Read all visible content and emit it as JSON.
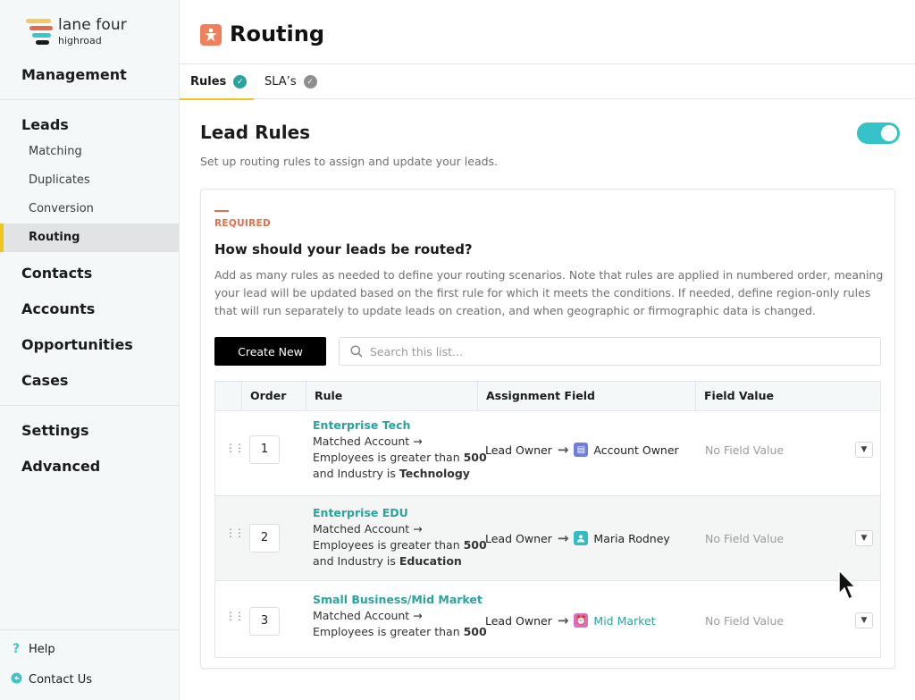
{
  "sidebar": {
    "logo": {
      "name": "lane four",
      "sub": "highroad"
    },
    "management": "Management",
    "leads": {
      "label": "Leads",
      "items": [
        {
          "label": "Matching",
          "active": false
        },
        {
          "label": "Duplicates",
          "active": false
        },
        {
          "label": "Conversion",
          "active": false
        },
        {
          "label": "Routing",
          "active": true
        }
      ]
    },
    "groups": [
      "Contacts",
      "Accounts",
      "Opportunities",
      "Cases"
    ],
    "settings": "Settings",
    "advanced": "Advanced",
    "footer": [
      {
        "label": "Help",
        "icon": "question-icon"
      },
      {
        "label": "Contact Us",
        "icon": "chat-icon"
      }
    ]
  },
  "header": {
    "title": "Routing",
    "tabs": [
      {
        "label": "Rules",
        "active": true,
        "status": "complete"
      },
      {
        "label": "SLA’s",
        "active": false,
        "status": "complete"
      }
    ]
  },
  "lead_rules": {
    "title": "Lead Rules",
    "description": "Set up routing rules to assign and update your leads.",
    "enabled": true
  },
  "card": {
    "required_label": "REQUIRED",
    "question": "How should your leads be routed?",
    "description": "Add as many rules as needed to define your routing scenarios. Note that rules are applied in numbered order, meaning your lead will be updated based on the first rule for which it meets the conditions. If needed, define region-only rules that will run separately to update leads on creation, and when geographic or firmographic data is changed.",
    "create_button": "Create New",
    "search_placeholder": "Search this list...",
    "table": {
      "columns": [
        "Order",
        "Rule",
        "Assignment Field",
        "Field Value"
      ],
      "rows": [
        {
          "order": "1",
          "name": "Enterprise Tech",
          "line1": "Matched Account →",
          "line2_pre": "Employees is greater than ",
          "line2_bold": "500",
          "line3_pre": "and Industry is ",
          "line3_bold": "Technology",
          "field": "Lead Owner",
          "target": "Account Owner",
          "target_icon": "account-icon",
          "target_color": "#6f7fd9",
          "value": "No Field Value"
        },
        {
          "order": "2",
          "name": "Enterprise EDU",
          "line1": "Matched Account →",
          "line2_pre": "Employees is greater than ",
          "line2_bold": "500",
          "line3_pre": "and Industry is ",
          "line3_bold": "Education",
          "field": "Lead Owner",
          "target": "Maria Rodney",
          "target_icon": "user-icon",
          "target_color": "#35b9c4",
          "value": "No Field Value"
        },
        {
          "order": "3",
          "name": "Small Business/Mid Market",
          "line1": "Matched Account →",
          "line2_pre": "Employees is greater than ",
          "line2_bold": "500",
          "field": "Lead Owner",
          "target": "Mid Market",
          "target_icon": "queue-icon",
          "target_color": "#d86fc2",
          "value": "No Field Value"
        }
      ]
    }
  },
  "colors": {
    "accent_yellow": "#f0c419",
    "teal": "#35c2c9",
    "orange": "#f07f5b",
    "rule_name": "#2aa39f"
  }
}
